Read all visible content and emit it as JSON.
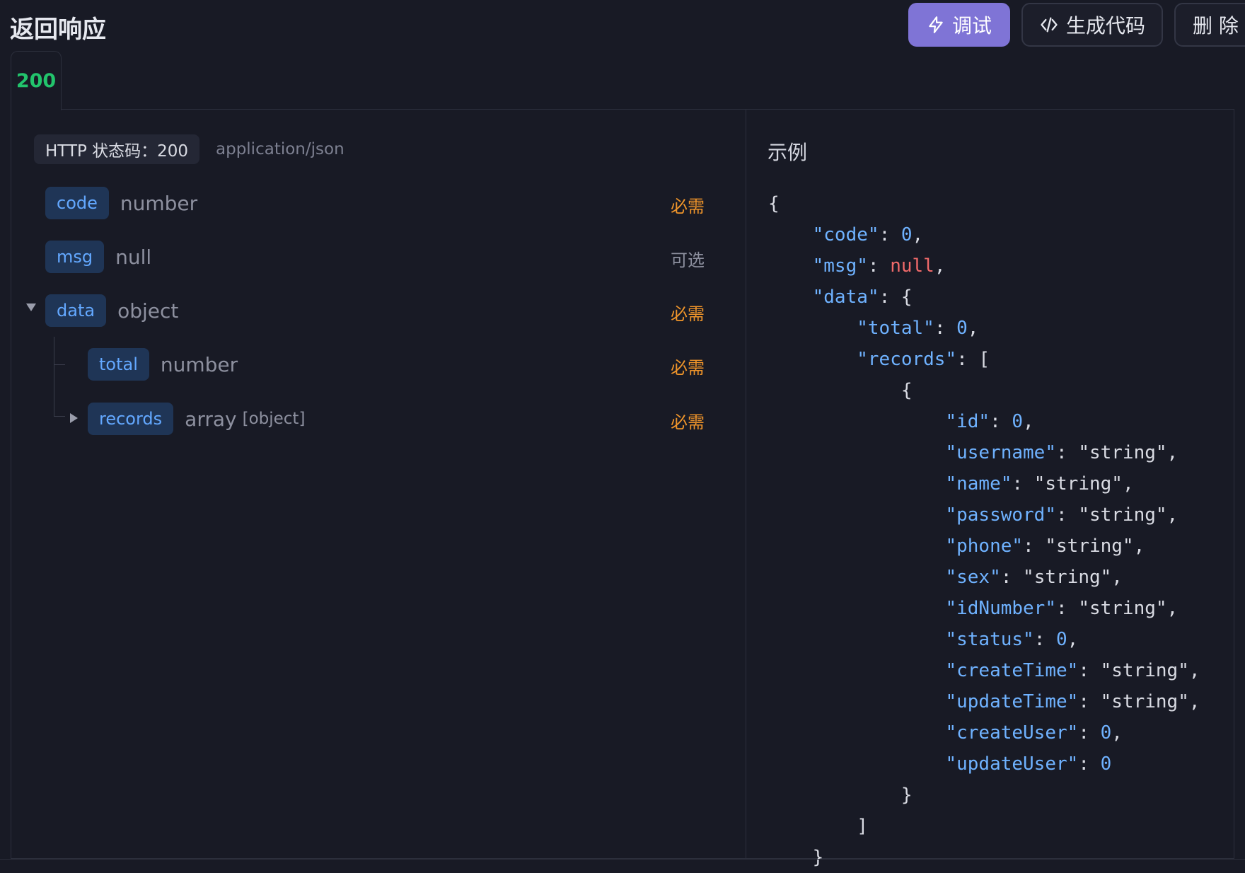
{
  "header": {
    "title": "返回响应",
    "debug_label": "调试",
    "code_label": "生成代码",
    "delete_label": "删 除"
  },
  "tabs": [
    {
      "label": "200",
      "active": true
    }
  ],
  "response": {
    "status_label": "HTTP 状态码：200",
    "content_type": "application/json",
    "fields": [
      {
        "name": "code",
        "type": "number",
        "required": "必需"
      },
      {
        "name": "msg",
        "type": "null",
        "required": "可选"
      },
      {
        "name": "data",
        "type": "object",
        "required": "必需"
      },
      {
        "name": "total",
        "type": "number",
        "required": "必需"
      },
      {
        "name": "records",
        "type": "array",
        "subtype": "[object]",
        "required": "必需"
      }
    ]
  },
  "example": {
    "title": "示例",
    "lines": [
      {
        "indent": 0,
        "text": "{"
      },
      {
        "indent": 1,
        "key": "code",
        "value": "0",
        "vtype": "num",
        "comma": true
      },
      {
        "indent": 1,
        "key": "msg",
        "value": "null",
        "vtype": "null",
        "comma": true
      },
      {
        "indent": 1,
        "key": "data",
        "value": "{",
        "vtype": "punct",
        "comma": false
      },
      {
        "indent": 2,
        "key": "total",
        "value": "0",
        "vtype": "num",
        "comma": true
      },
      {
        "indent": 2,
        "key": "records",
        "value": "[",
        "vtype": "punct",
        "comma": false
      },
      {
        "indent": 3,
        "text": "{"
      },
      {
        "indent": 4,
        "key": "id",
        "value": "0",
        "vtype": "num",
        "comma": true
      },
      {
        "indent": 4,
        "key": "username",
        "value": "\"string\"",
        "vtype": "str",
        "comma": true
      },
      {
        "indent": 4,
        "key": "name",
        "value": "\"string\"",
        "vtype": "str",
        "comma": true
      },
      {
        "indent": 4,
        "key": "password",
        "value": "\"string\"",
        "vtype": "str",
        "comma": true
      },
      {
        "indent": 4,
        "key": "phone",
        "value": "\"string\"",
        "vtype": "str",
        "comma": true
      },
      {
        "indent": 4,
        "key": "sex",
        "value": "\"string\"",
        "vtype": "str",
        "comma": true
      },
      {
        "indent": 4,
        "key": "idNumber",
        "value": "\"string\"",
        "vtype": "str",
        "comma": true
      },
      {
        "indent": 4,
        "key": "status",
        "value": "0",
        "vtype": "num",
        "comma": true
      },
      {
        "indent": 4,
        "key": "createTime",
        "value": "\"string\"",
        "vtype": "str",
        "comma": true
      },
      {
        "indent": 4,
        "key": "updateTime",
        "value": "\"string\"",
        "vtype": "str",
        "comma": true
      },
      {
        "indent": 4,
        "key": "createUser",
        "value": "0",
        "vtype": "num",
        "comma": true
      },
      {
        "indent": 4,
        "key": "updateUser",
        "value": "0",
        "vtype": "num",
        "comma": false
      },
      {
        "indent": 3,
        "text": "}"
      },
      {
        "indent": 2,
        "text": "]"
      },
      {
        "indent": 1,
        "text": "}"
      }
    ]
  },
  "colors": {
    "accent": "#7f74d6",
    "success": "#22c46c",
    "required": "#f0952a",
    "key": "#6fb2ff",
    "null": "#f06a6a"
  }
}
